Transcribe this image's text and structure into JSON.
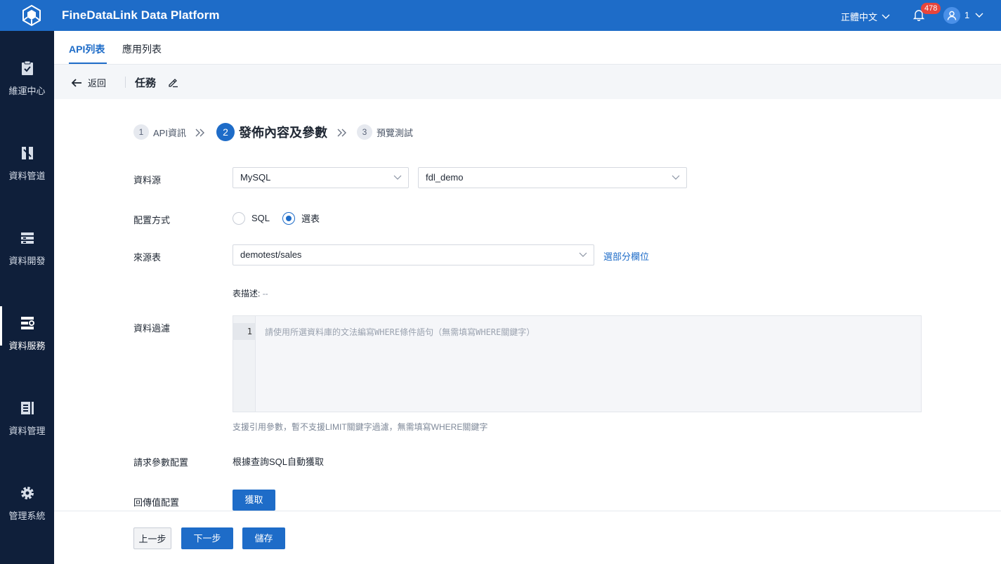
{
  "header": {
    "title": "FineDataLink Data Platform",
    "language": "正體中文",
    "notification_count": "478",
    "user": "1"
  },
  "sidebar": {
    "items": [
      {
        "label": "維運中心",
        "icon": "clipboard-check-icon"
      },
      {
        "label": "資料管道",
        "icon": "pipeline-icon"
      },
      {
        "label": "資料開發",
        "icon": "server-stack-icon"
      },
      {
        "label": "資料服務",
        "icon": "api-service-icon",
        "active": true
      },
      {
        "label": "資料管理",
        "icon": "data-management-icon"
      },
      {
        "label": "管理系統",
        "icon": "gear-icon"
      }
    ]
  },
  "tabs": {
    "api_list": "API列表",
    "app_list": "應用列表"
  },
  "backbar": {
    "back_label": "返回",
    "task_title": "任務"
  },
  "steps": [
    {
      "num": "1",
      "label": "API資訊"
    },
    {
      "num": "2",
      "label": "發佈內容及參數"
    },
    {
      "num": "3",
      "label": "預覽測試"
    }
  ],
  "form": {
    "datasource_label": "資料源",
    "datasource_type": "MySQL",
    "datasource_name": "fdl_demo",
    "config_label": "配置方式",
    "config_options": [
      "SQL",
      "選表"
    ],
    "config_selected": "選表",
    "source_table_label": "來源表",
    "source_table": "demotest/sales",
    "select_fields_link": "選部分欄位",
    "table_desc_label": "表描述:",
    "table_desc_value": "--",
    "filter_label": "資料過濾",
    "editor_line": "1",
    "editor_placeholder": "請使用所選資料庫的文法編寫WHERE條件語句（無需填寫WHERE關鍵字）",
    "filter_hint": "支援引用參數，暫不支援LIMIT關鍵字過濾，無需填寫WHERE關鍵字",
    "request_param_label": "請求參數配置",
    "request_param_text": "根據查詢SQL自動獲取",
    "return_label": "回傳值配置",
    "fetch_button": "獲取"
  },
  "footer": {
    "prev": "上一步",
    "next": "下一步",
    "save": "儲存"
  },
  "colors": {
    "primary": "#1e6cc8",
    "sidebar": "#0f1f3a",
    "badge": "#e8453c"
  }
}
